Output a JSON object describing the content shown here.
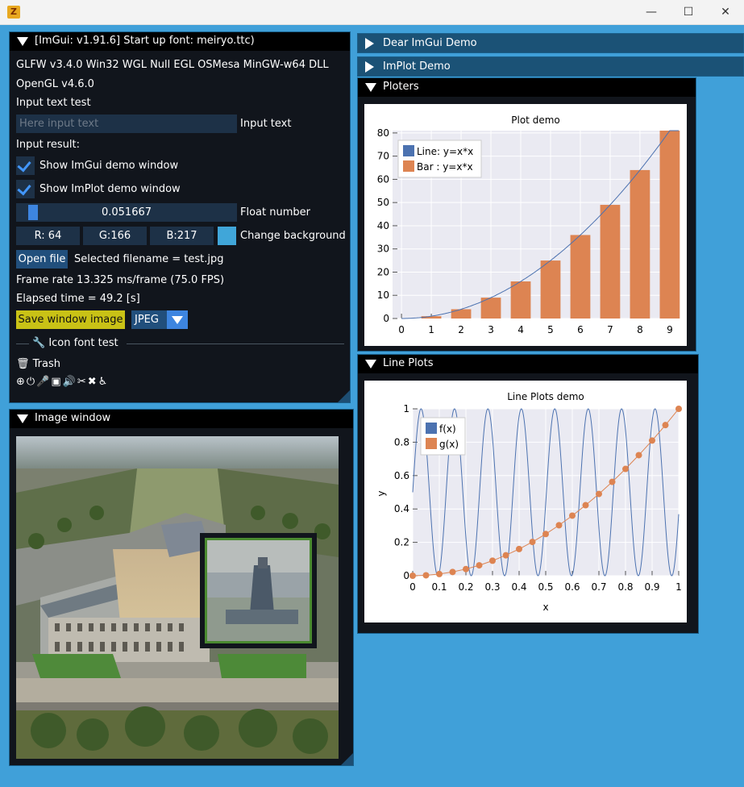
{
  "os": {
    "app_icon": "Z",
    "minimize": "—",
    "maximize": "☐",
    "close": "✕"
  },
  "main_window": {
    "title": "[ImGui: v1.91.6] Start up font: meiryo.ttc)",
    "glfw_line": "GLFW v3.4.0 Win32 WGL Null EGL OSMesa MinGW-w64 DLL",
    "opengl_line": "OpenGL v4.6.0",
    "input_label": "Input text test",
    "input_placeholder": "Here input text",
    "input_suffix": "Input text",
    "input_result": "Input result:",
    "show_imgui_demo": "Show ImGui demo window",
    "show_implot_demo": "Show ImPlot demo window",
    "slider_value": "0.051667",
    "slider_fraction": 0.051667,
    "slider_label": "Float number",
    "color_r": "R: 64",
    "color_g": "G:166",
    "color_b": "B:217",
    "color_swatch": "#40a6d9",
    "color_label": "Change background",
    "open_file": "Open file",
    "selected_file": "Selected filename = test.jpg",
    "frame_rate": "Frame rate  13.325 ms/frame (75.0 FPS)",
    "elapsed": "Elapsed time = 49.2 [s]",
    "save_button": "Save window image",
    "format_value": "JPEG",
    "icon_section": "Icon font test",
    "trash_label": "Trash",
    "icon_names": [
      "search-plus-icon",
      "power-icon",
      "microphone-icon",
      "microchip-icon",
      "volume-icon",
      "scissors-icon",
      "tools-icon",
      "accessibility-icon"
    ]
  },
  "image_window": {
    "title": "Image window"
  },
  "collapsed_windows": {
    "dear_imgui": "Dear ImGui Demo",
    "implot": "ImPlot Demo"
  },
  "ploters_window": {
    "title": "Ploters"
  },
  "lineplots_window": {
    "title": "Line Plots"
  },
  "chart_data": [
    {
      "type": "bar",
      "title": "Plot demo",
      "x": [
        0,
        1,
        2,
        3,
        4,
        5,
        6,
        7,
        8,
        9
      ],
      "series": [
        {
          "name": "Line: y=x*x",
          "type": "line",
          "values": [
            0,
            1,
            4,
            9,
            16,
            25,
            36,
            49,
            64,
            81
          ],
          "color": "#4c72b0"
        },
        {
          "name": "Bar : y=x*x",
          "type": "bar",
          "values": [
            0,
            1,
            4,
            9,
            16,
            25,
            36,
            49,
            64,
            81
          ],
          "color": "#dd8452"
        }
      ],
      "xlim": [
        -0.3,
        9.3
      ],
      "ylim": [
        0,
        81
      ],
      "xticks": [
        "0",
        "1",
        "2",
        "3",
        "4",
        "5",
        "6",
        "7",
        "8",
        "9"
      ],
      "yticks": [
        "0",
        "10",
        "20",
        "30",
        "40",
        "50",
        "60",
        "70",
        "80"
      ],
      "legend": "top-left",
      "grid": true
    },
    {
      "type": "line",
      "title": "Line Plots demo",
      "xlabel": "x",
      "ylabel": "y",
      "series": [
        {
          "name": "f(x)",
          "expression": "0.5 + 0.5*sin(50*x)",
          "samples": 1001,
          "color": "#4c72b0"
        },
        {
          "name": "g(x)",
          "x": [
            0,
            0.05,
            0.1,
            0.15,
            0.2,
            0.25,
            0.3,
            0.35,
            0.4,
            0.45,
            0.5,
            0.55,
            0.6,
            0.65,
            0.7,
            0.75,
            0.8,
            0.85,
            0.9,
            0.95,
            1.0
          ],
          "values": [
            0,
            0.0025,
            0.01,
            0.0225,
            0.04,
            0.0625,
            0.09,
            0.1225,
            0.16,
            0.2025,
            0.25,
            0.3025,
            0.36,
            0.4225,
            0.49,
            0.5625,
            0.64,
            0.7225,
            0.81,
            0.9025,
            1.0
          ],
          "color": "#dd8452",
          "markers": true
        }
      ],
      "xlim": [
        0,
        1
      ],
      "ylim": [
        0,
        1
      ],
      "xticks": [
        "0",
        "0.1",
        "0.2",
        "0.3",
        "0.4",
        "0.5",
        "0.6",
        "0.7",
        "0.8",
        "0.9",
        "1"
      ],
      "yticks": [
        "0",
        "0.2",
        "0.4",
        "0.6",
        "0.8",
        "1"
      ],
      "legend": "top-left",
      "grid": true
    }
  ]
}
